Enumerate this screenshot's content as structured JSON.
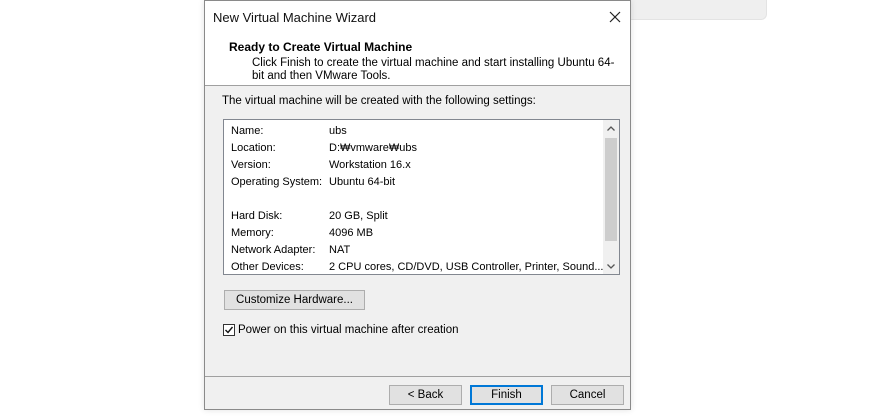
{
  "dialog": {
    "title": "New Virtual Machine Wizard",
    "header_title": "Ready to Create Virtual Machine",
    "header_desc": "Click Finish to create the virtual machine and start installing Ubuntu 64-bit and then VMware Tools."
  },
  "intro": "The virtual machine will be created with the following settings:",
  "settings": [
    {
      "key": "Name:",
      "value": "ubs"
    },
    {
      "key": "Location:",
      "value": "D:₩vmware₩ubs"
    },
    {
      "key": "Version:",
      "value": "Workstation 16.x"
    },
    {
      "key": "Operating System:",
      "value": "Ubuntu 64-bit"
    },
    {
      "key": "Hard Disk:",
      "value": "20 GB, Split"
    },
    {
      "key": "Memory:",
      "value": "4096 MB"
    },
    {
      "key": "Network Adapter:",
      "value": "NAT"
    },
    {
      "key": "Other Devices:",
      "value": "2 CPU cores, CD/DVD, USB Controller, Printer, Sound..."
    }
  ],
  "buttons": {
    "customize": "Customize Hardware...",
    "back": "< Back",
    "finish": "Finish",
    "cancel": "Cancel"
  },
  "power_on": {
    "label": "Power on this virtual machine after creation",
    "checked": true
  },
  "icons": {
    "close": "close-icon",
    "scroll_up": "chevron-up-icon",
    "scroll_down": "chevron-down-icon",
    "check": "checkmark-icon"
  }
}
